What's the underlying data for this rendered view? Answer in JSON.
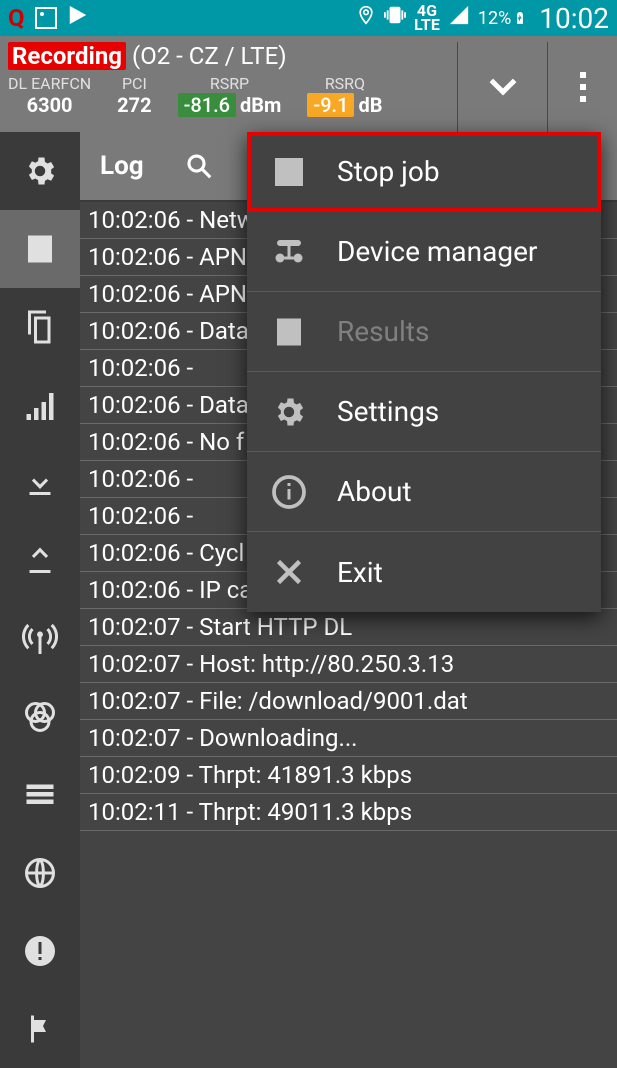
{
  "status_bar": {
    "q_icon": "Q",
    "network_type": "4G\nLTE",
    "battery": "12%",
    "time": "10:02"
  },
  "header": {
    "recording_label": "Recording",
    "network_name": "(O2 - CZ  / LTE)",
    "stats": {
      "earfcn": {
        "label": "DL EARFCN",
        "value": "6300"
      },
      "pci": {
        "label": "PCI",
        "value": "272"
      },
      "rsrp": {
        "label": "RSRP",
        "value": "-81.6",
        "unit": "dBm"
      },
      "rsrq": {
        "label": "RSRQ",
        "value": "-9.1",
        "unit": "dB"
      }
    }
  },
  "tabs": {
    "log_label": "Log"
  },
  "log_entries": [
    "10:02:06 - Netw",
    "10:02:06 - APN",
    "10:02:06 - APN",
    "10:02:06 - Data",
    "10:02:06 - ",
    "10:02:06 - Data",
    "10:02:06 - No f",
    "10:02:06 - ",
    "10:02:06 - ",
    "10:02:06 - Cycl",
    "10:02:06 - IP ca",
    "10:02:07 - Start HTTP DL",
    "10:02:07 - Host: http://80.250.3.13",
    "10:02:07 - File: /download/9001.dat",
    "10:02:07 - Downloading...",
    "10:02:09 - Thrpt: 41891.3 kbps",
    "10:02:11 - Thrpt: 49011.3 kbps"
  ],
  "menu": {
    "stop_job": "Stop job",
    "device_manager": "Device manager",
    "results": "Results",
    "settings": "Settings",
    "about": "About",
    "exit": "Exit"
  }
}
